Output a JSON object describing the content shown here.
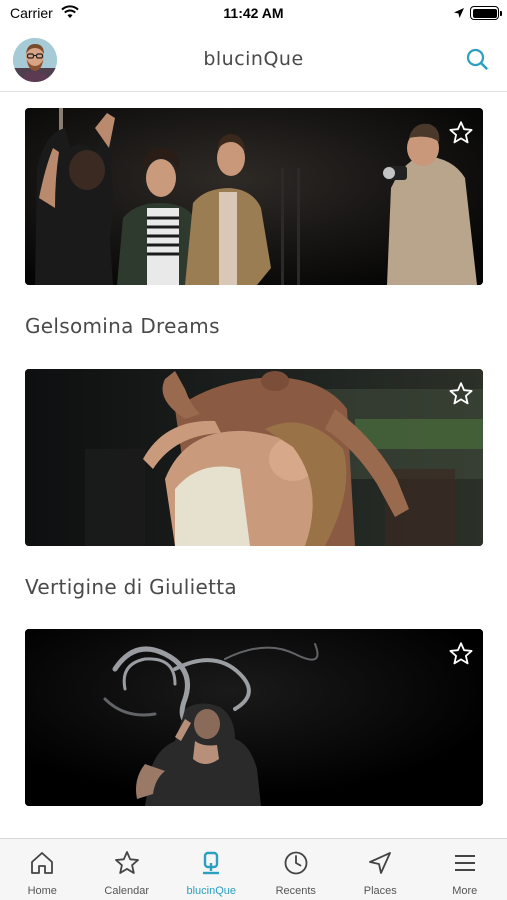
{
  "status_bar": {
    "carrier": "Carrier",
    "time": "11:42 AM"
  },
  "nav": {
    "title": "blucinQue",
    "search_icon": "search-icon",
    "avatar": "user-avatar"
  },
  "feed": {
    "items": [
      {
        "title": "Gelsomina Dreams",
        "icon": "star-outline-icon"
      },
      {
        "title": "Vertigine di Giulietta",
        "icon": "star-outline-icon"
      },
      {
        "title": "",
        "icon": "star-outline-icon"
      }
    ]
  },
  "tabs": [
    {
      "label": "Home",
      "icon": "home-icon",
      "active": false
    },
    {
      "label": "Calendar",
      "icon": "star-icon",
      "active": false
    },
    {
      "label": "blucinQue",
      "icon": "blucinque-q-icon",
      "active": true
    },
    {
      "label": "Recents",
      "icon": "clock-icon",
      "active": false
    },
    {
      "label": "Places",
      "icon": "navigation-arrow-icon",
      "active": false
    },
    {
      "label": "More",
      "icon": "menu-icon",
      "active": false
    }
  ],
  "colors": {
    "accent": "#2a9fc0",
    "text": "#4a4a4a",
    "tab_bar": "#f6f6f6"
  }
}
